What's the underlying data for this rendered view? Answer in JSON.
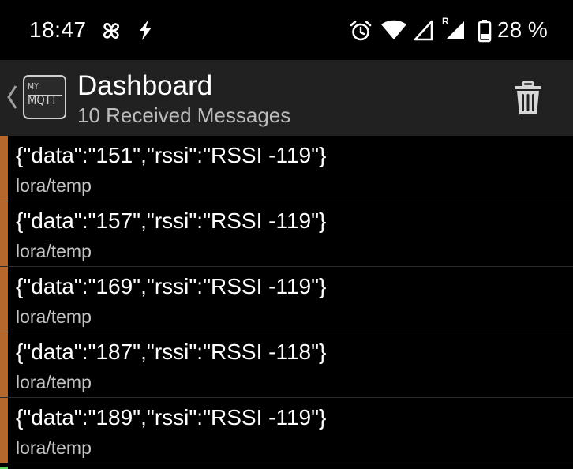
{
  "status_bar": {
    "time": "18:47",
    "battery_percent": "28 %",
    "icons": [
      "fan-icon",
      "bolt-icon",
      "alarm-icon",
      "wifi-icon",
      "signal-icon",
      "signal-roaming-icon",
      "battery-icon"
    ]
  },
  "app_bar": {
    "logo": {
      "line1": "MY",
      "line2": "MQTT"
    },
    "title": "Dashboard",
    "subtitle": "10 Received Messages",
    "actions": [
      "delete-icon"
    ]
  },
  "messages": [
    {
      "payload": "{\"data\":\"151\",\"rssi\":\"RSSI -119\"}",
      "topic": "lora/temp"
    },
    {
      "payload": "{\"data\":\"157\",\"rssi\":\"RSSI -119\"}",
      "topic": "lora/temp"
    },
    {
      "payload": "{\"data\":\"169\",\"rssi\":\"RSSI -119\"}",
      "topic": "lora/temp"
    },
    {
      "payload": "{\"data\":\"187\",\"rssi\":\"RSSI -118\"}",
      "topic": "lora/temp"
    },
    {
      "payload": "{\"data\":\"189\",\"rssi\":\"RSSI -119\"}",
      "topic": "lora/temp"
    }
  ],
  "colors": {
    "background": "#000000",
    "app_bar": "#212121",
    "message_accent": "#b5672c",
    "next_accent": "#5fd35f",
    "subtitle_text": "#bdbdbd",
    "topic_text": "#c4c4c4"
  }
}
